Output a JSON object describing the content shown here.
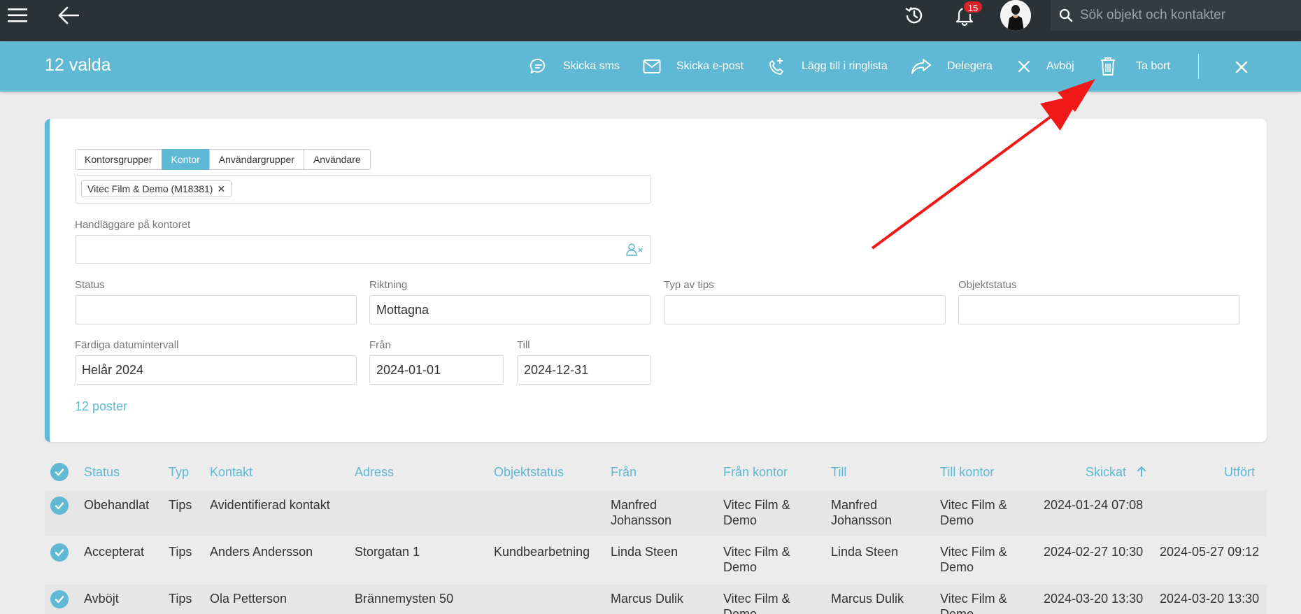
{
  "topbar": {
    "menu_icon": "hamburger-icon",
    "back_icon": "arrow-left-icon",
    "history_icon": "history-icon",
    "bell_icon": "bell-icon",
    "notification_count": "15",
    "search_placeholder": "Sök objekt och kontakter"
  },
  "selection": {
    "count_label": "12 valda",
    "actions": [
      {
        "label": "Skicka sms",
        "icon": "chat-bubble-icon"
      },
      {
        "label": "Skicka e-post",
        "icon": "envelope-icon"
      },
      {
        "label": "Lägg till i ringlista",
        "icon": "phone-plus-icon"
      },
      {
        "label": "Delegera",
        "icon": "share-arrow-icon"
      },
      {
        "label": "Avböj",
        "icon": "x-icon"
      },
      {
        "label": "Ta bort",
        "icon": "trash-icon"
      }
    ],
    "close_icon": "close-icon"
  },
  "filters": {
    "tabs": [
      "Kontorsgrupper",
      "Kontor",
      "Användargrupper",
      "Användare"
    ],
    "active_tab": "Kontor",
    "selected_chip": "Vitec Film & Demo (M18381)",
    "handlaggare_label": "Handläggare på kontoret",
    "status_label": "Status",
    "status_value": "",
    "riktning_label": "Riktning",
    "riktning_value": "Mottagna",
    "typ_label": "Typ av tips",
    "typ_value": "",
    "objektstatus_label": "Objektstatus",
    "objektstatus_value": "",
    "datum_label": "Färdiga datumintervall",
    "datum_value": "Helår 2024",
    "fran_label": "Från",
    "fran_value": "2024-01-01",
    "till_label": "Till",
    "till_value": "2024-12-31",
    "count_text": "12 poster"
  },
  "table": {
    "headers": [
      "Status",
      "Typ",
      "Kontakt",
      "Adress",
      "Objektstatus",
      "Från",
      "Från kontor",
      "Till",
      "Till kontor",
      "Skickat",
      "Utfört"
    ],
    "rows": [
      {
        "status": "Obehandlat",
        "typ": "Tips",
        "kontakt": "Avidentifierad kontakt",
        "adress": "",
        "objektstatus": "",
        "fran": "Manfred Johansson",
        "fran_kontor": "Vitec Film & Demo",
        "till": "Manfred Johansson",
        "till_kontor": "Vitec Film & Demo",
        "skickat": "2024-01-24 07:08",
        "utfort": ""
      },
      {
        "status": "Accepterat",
        "typ": "Tips",
        "kontakt": "Anders Andersson",
        "adress": "Storgatan 1",
        "objektstatus": "Kundbearbetning",
        "fran": "Linda Steen",
        "fran_kontor": "Vitec Film & Demo",
        "till": "Linda Steen",
        "till_kontor": "Vitec Film & Demo",
        "skickat": "2024-02-27 10:30",
        "utfort": "2024-05-27 09:12"
      },
      {
        "status": "Avböjt",
        "typ": "Tips",
        "kontakt": "Ola Petterson",
        "adress": "Brännemysten 50",
        "objektstatus": "",
        "fran": "Marcus Dulik",
        "fran_kontor": "Vitec Film & Demo",
        "till": "Marcus Dulik",
        "till_kontor": "Vitec Film & Demo",
        "skickat": "2024-03-20 13:30",
        "utfort": "2024-03-20 13:30"
      }
    ]
  },
  "colors": {
    "accent": "#5fb8d4",
    "topbar": "#2b3235",
    "annotation_arrow": "#f01818"
  }
}
